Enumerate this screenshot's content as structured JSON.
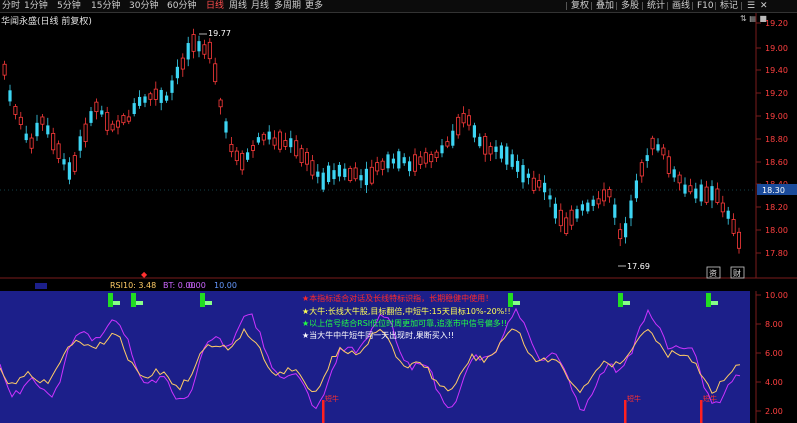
{
  "toolbar": {
    "left_items": [
      "分时",
      "1分钟",
      "5分钟",
      "15分钟",
      "30分钟",
      "60分钟",
      "日线",
      "周线",
      "月线",
      "多周期",
      "更多"
    ],
    "active": "日线",
    "right_items": [
      "复权",
      "叠加",
      "多股",
      "统计",
      "画线",
      "F10",
      "标记"
    ]
  },
  "window": {
    "title": "华闻永盛(日线 前复权)",
    "buttons": "⇅ ▤ ■"
  },
  "price_axis": {
    "ticks": [
      "19.20",
      "19.00",
      "19.40",
      "19.20",
      "19.00",
      "18.80",
      "18.60",
      "18.40",
      "18.20",
      "18.00",
      "17.80"
    ],
    "current": "18.30",
    "high_label": "19.77",
    "low_label": "17.69"
  },
  "indicator": {
    "header": {
      "rsi_label": "RSI10: 3.48",
      "bt_label": "BT: 0.00",
      "v1": "0.00",
      "v2": "10.00"
    },
    "ticks": [
      "10.00",
      "8.00",
      "6.00",
      "4.00",
      "2.00"
    ],
    "notes": [
      {
        "text": "★本指标适合对话及长线特标识指，长期稳健中使用！",
        "color": "#ff2a2a"
      },
      {
        "text": "★大牛:长线大牛股,目标翻倍,中短牛:15天目标10%-20%!!",
        "color": "#ffff55"
      },
      {
        "text": "★以上信号结合RSI低位时周更加可靠,追涨市中信号偏多!!",
        "color": "#22ff44"
      },
      {
        "text": "★当大牛中牛短牛同一天出现时,果断买入!!",
        "color": "#ffffff"
      }
    ],
    "signal_label": "短牛"
  },
  "bottom_right_boxes": [
    "资",
    "财"
  ],
  "colors": {
    "up": "#ff3b3b",
    "down": "#3dd5f3",
    "indicator_bg": "#1c1f8a",
    "rsi_line": "#ffcc66",
    "bt_line": "#cc33ff",
    "signal_green": "#22dd22"
  }
}
